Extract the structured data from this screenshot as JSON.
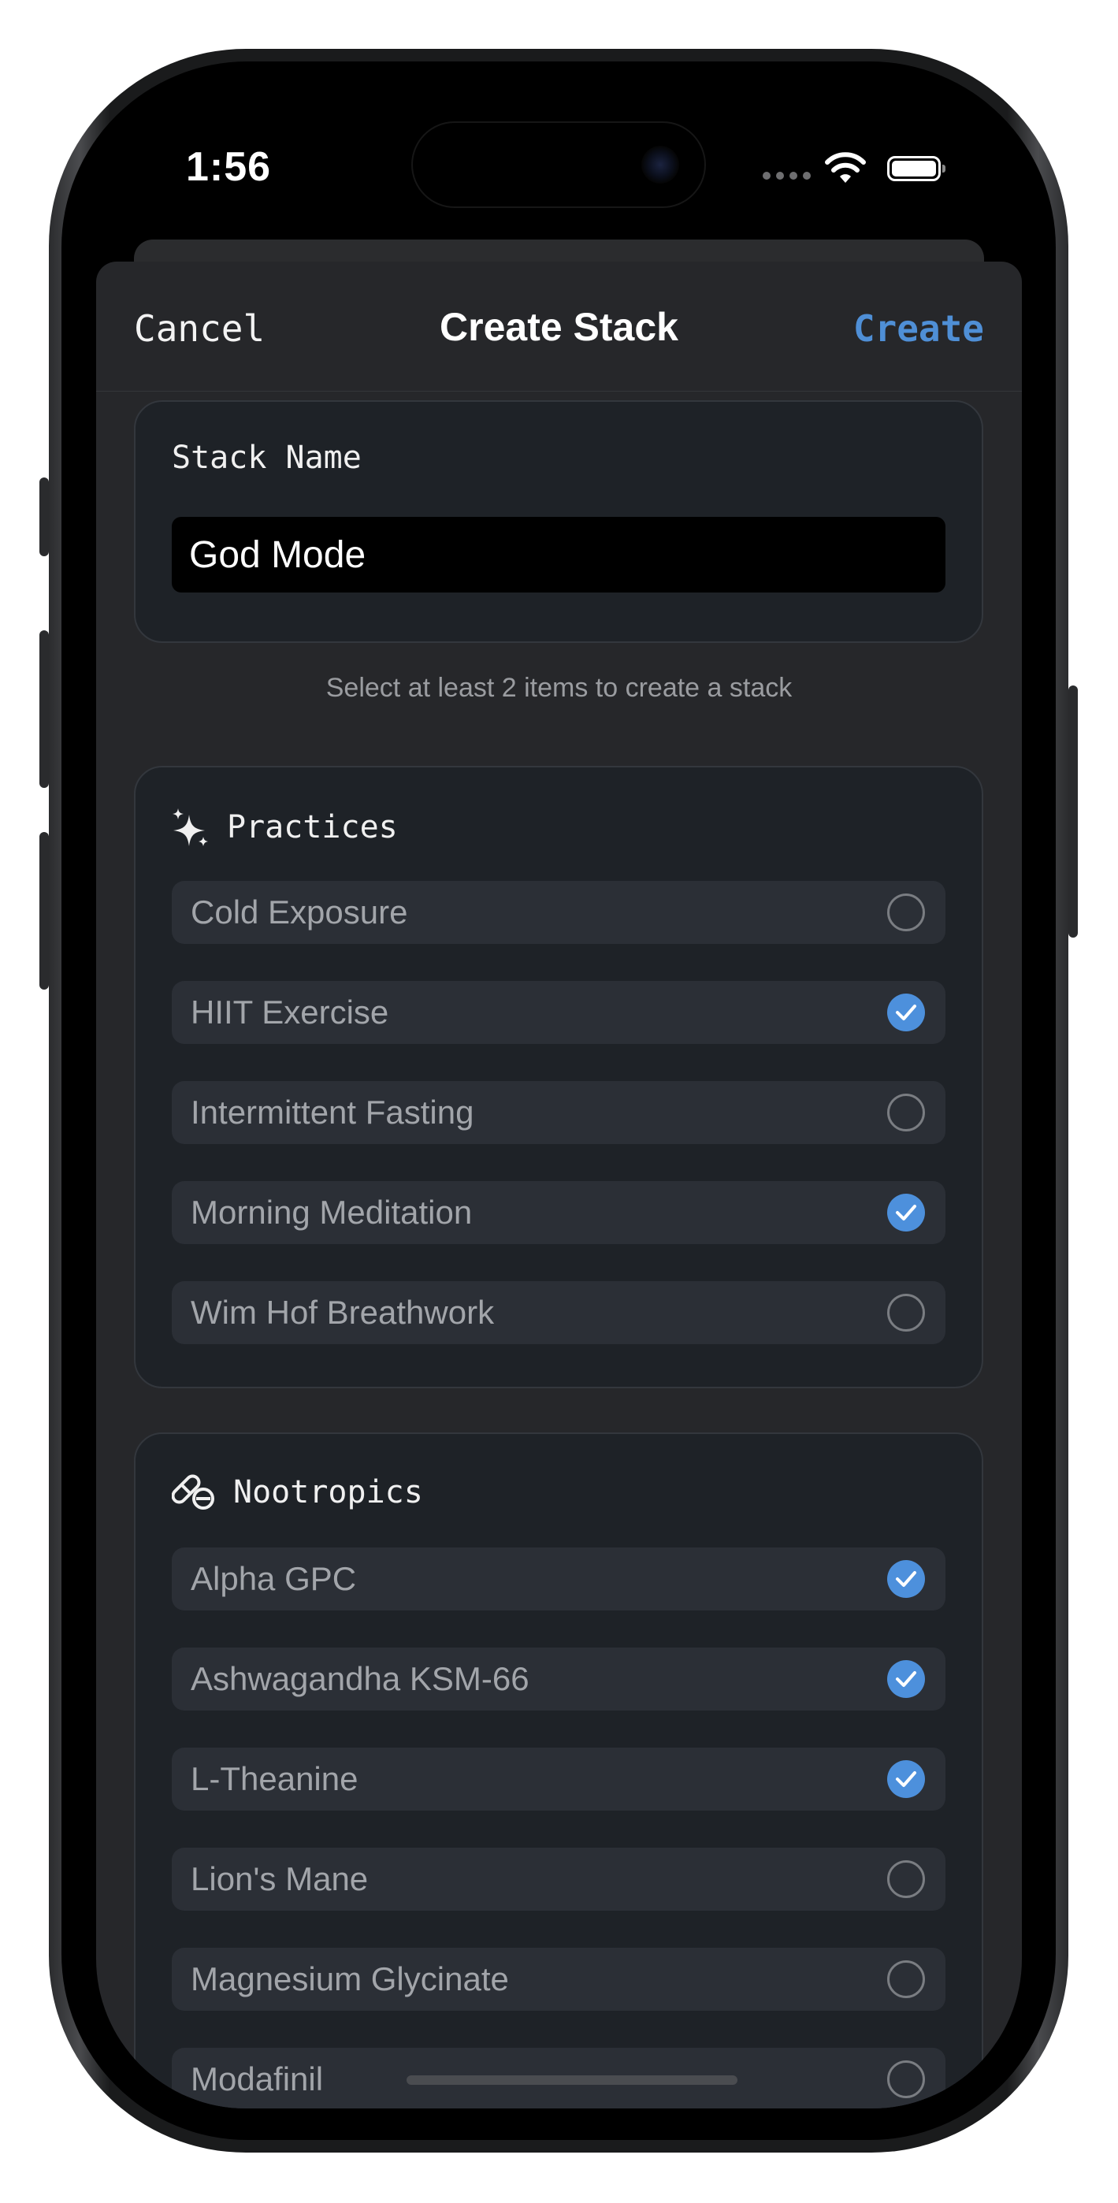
{
  "status_bar": {
    "time": "1:56"
  },
  "nav": {
    "cancel_label": "Cancel",
    "title": "Create Stack",
    "create_label": "Create"
  },
  "stack_name": {
    "label": "Stack Name",
    "value": "God Mode"
  },
  "hint": "Select at least 2 items to create a stack",
  "practices": {
    "title": "Practices",
    "icon": "sparkles-icon",
    "items": [
      {
        "label": "Cold Exposure",
        "selected": false
      },
      {
        "label": "HIIT Exercise",
        "selected": true
      },
      {
        "label": "Intermittent Fasting",
        "selected": false
      },
      {
        "label": "Morning Meditation",
        "selected": true
      },
      {
        "label": "Wim Hof Breathwork",
        "selected": false
      }
    ]
  },
  "nootropics": {
    "title": "Nootropics",
    "icon": "pills-icon",
    "items": [
      {
        "label": "Alpha GPC",
        "selected": true
      },
      {
        "label": "Ashwagandha KSM-66",
        "selected": true
      },
      {
        "label": "L-Theanine",
        "selected": true
      },
      {
        "label": "Lion's Mane",
        "selected": false
      },
      {
        "label": "Magnesium Glycinate",
        "selected": false
      },
      {
        "label": "Modafinil",
        "selected": false
      }
    ]
  },
  "colors": {
    "accent": "#4d90dc",
    "background": "#26272a",
    "card": "#1e2227",
    "row": "#2b2f36"
  }
}
